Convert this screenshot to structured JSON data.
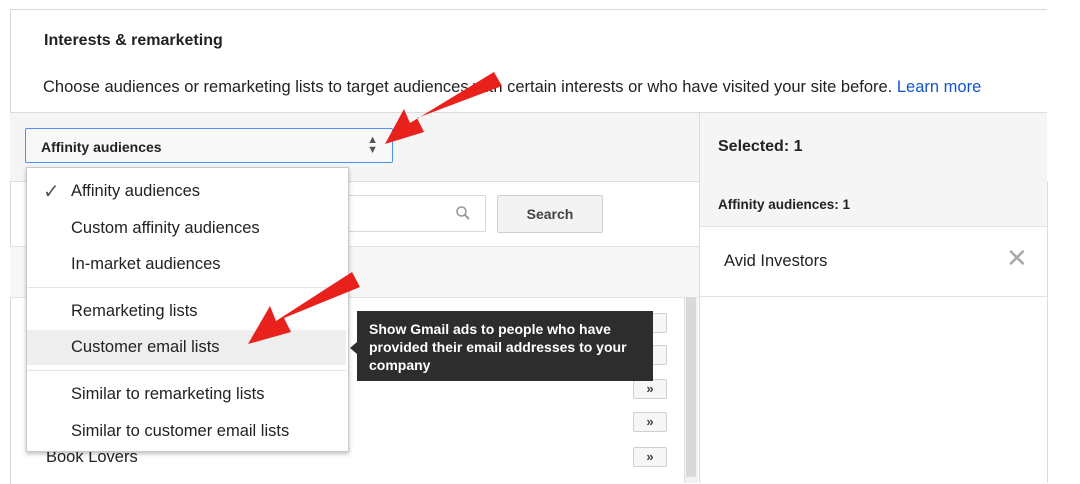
{
  "section": {
    "title": "Interests & remarketing",
    "description": "Choose audiences or remarketing lists to target audiences with certain interests or who have visited your site before.",
    "learn_more": "Learn more"
  },
  "dropdown": {
    "selected": "Affinity audiences",
    "options": [
      {
        "label": "Affinity audiences",
        "checked": true
      },
      {
        "label": "Custom affinity audiences"
      },
      {
        "label": "In-market audiences"
      },
      {
        "label": "Remarketing lists"
      },
      {
        "label": "Customer email lists",
        "highlighted": true
      },
      {
        "label": "Similar to remarketing lists"
      },
      {
        "label": "Similar to customer email lists"
      }
    ]
  },
  "search": {
    "button_label": "Search",
    "icon": "search-icon"
  },
  "tooltip": {
    "text": "Show Gmail ads to people who have provided their email addresses to your company"
  },
  "list": {
    "visible_item": "Book Lovers",
    "add_symbol": "»"
  },
  "selected_panel": {
    "title": "Selected: 1",
    "group_label": "Affinity audiences: 1",
    "items": [
      {
        "label": "Avid Investors",
        "remove_icon": "close-icon"
      }
    ]
  },
  "colors": {
    "link": "#1155cc",
    "focus_border": "#4d90fe",
    "tooltip_bg": "#2d2d2d",
    "annotation_arrow": "#e8211d"
  }
}
